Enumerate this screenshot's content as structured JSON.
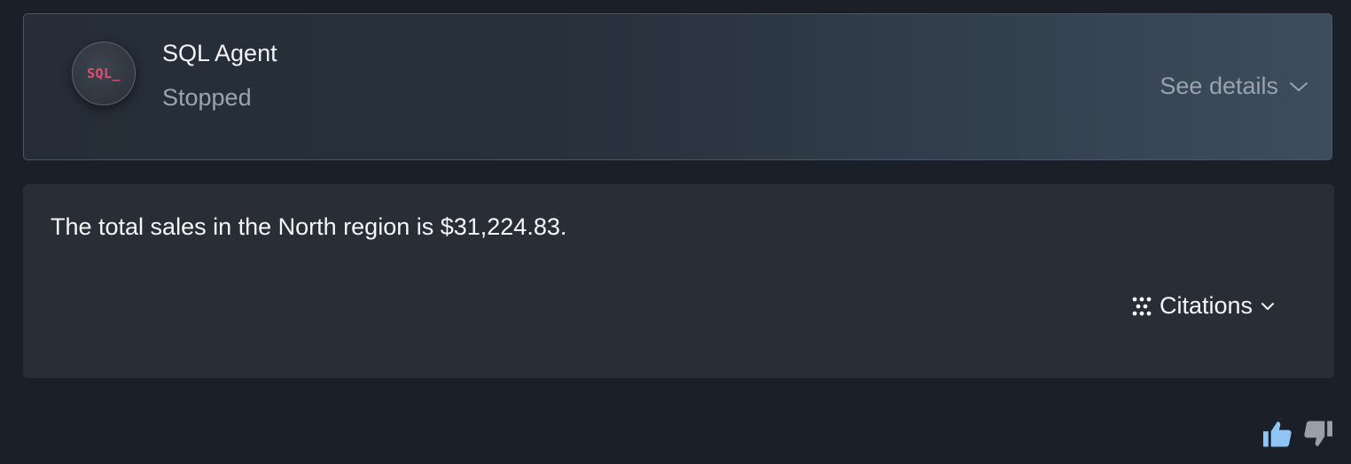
{
  "agent": {
    "avatar_text": "SQL_",
    "name": "SQL Agent",
    "status": "Stopped",
    "details_label": "See details"
  },
  "answer": {
    "text": "The total sales in the North region is $31,224.83.",
    "citations_label": "Citations"
  },
  "feedback": {
    "thumbs_up_color": "#8ec5f5",
    "thumbs_down_color": "#9aa0a8"
  },
  "icons": {
    "details_chevron": "chevron-down-icon",
    "citations_icon": "dots-grid-icon",
    "citations_chevron": "chevron-down-icon",
    "thumbs_up": "thumbs-up-icon",
    "thumbs_down": "thumbs-down-icon"
  },
  "colors": {
    "background": "#1b1f27",
    "agent_card": "#27303b",
    "answer_card": "#292d35",
    "avatar_text": "#e0506b"
  }
}
